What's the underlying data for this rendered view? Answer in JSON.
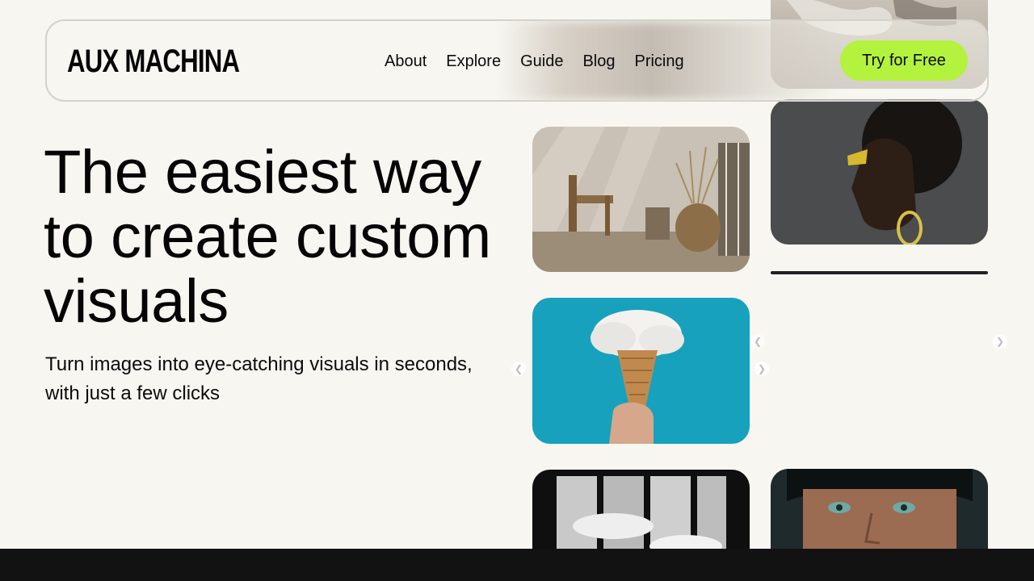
{
  "brand": {
    "logo_text": "AUX MACHINA"
  },
  "nav": {
    "links": [
      {
        "label": "About"
      },
      {
        "label": "Explore"
      },
      {
        "label": "Guide"
      },
      {
        "label": "Blog"
      },
      {
        "label": "Pricing"
      }
    ],
    "cta_label": "Try for Free"
  },
  "hero": {
    "title": "The easiest way to create custom visuals",
    "subtitle": "Turn images into eye-catching visuals in seconds, with just a few clicks"
  },
  "gallery": {
    "arrows": {
      "prev_icon": "chevron-left-icon",
      "next_icon": "chevron-right-icon"
    }
  },
  "colors": {
    "background": "#f7f6f1",
    "accent": "#b3f23d",
    "text": "#0b0b0b",
    "footer": "#121212"
  }
}
